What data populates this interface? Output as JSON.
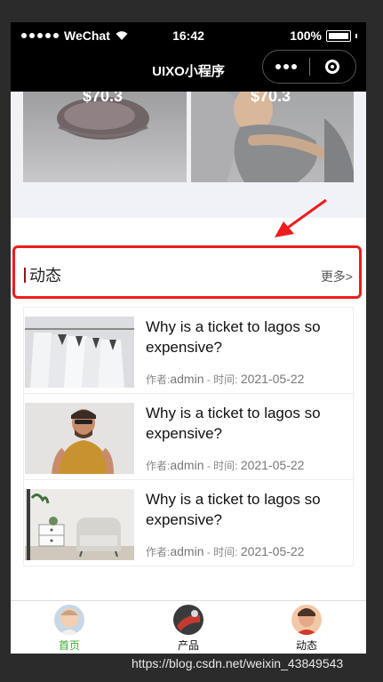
{
  "status_bar": {
    "carrier": "WeChat",
    "time": "16:42",
    "battery": "100%"
  },
  "nav": {
    "title": "UIXO小程序"
  },
  "products": [
    {
      "price": "$70.3"
    },
    {
      "price": "$70.3"
    }
  ],
  "section": {
    "title": "动态",
    "more": "更多>"
  },
  "news": [
    {
      "title": "Why is a ticket to lagos so expensive?",
      "author_label": "作者:",
      "author": "admin",
      "time_label": " - 时间: ",
      "date": "2021-05-22"
    },
    {
      "title": "Why is a ticket to lagos so expensive?",
      "author_label": "作者:",
      "author": "admin",
      "time_label": " - 时间: ",
      "date": "2021-05-22"
    },
    {
      "title": "Why is a ticket to lagos so expensive?",
      "author_label": "作者:",
      "author": "admin",
      "time_label": " - 时间: ",
      "date": "2021-05-22"
    }
  ],
  "tabbar": [
    {
      "label": "首页"
    },
    {
      "label": "产品"
    },
    {
      "label": "动态"
    }
  ],
  "colors": {
    "accent_green": "#3cb034",
    "annotation_red": "#ee1c1c",
    "section_bar": "#8b1a1a"
  },
  "watermark": "https://blog.csdn.net/weixin_43849543"
}
